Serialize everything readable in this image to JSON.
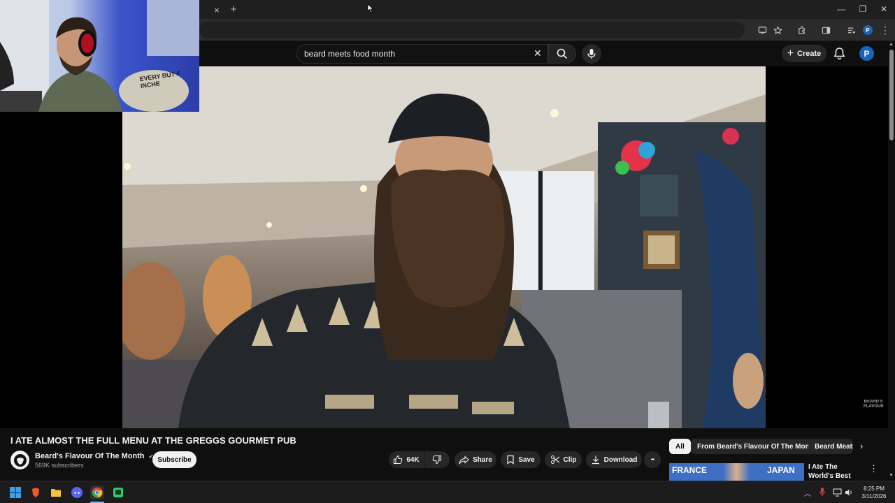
{
  "browser": {
    "new_tab_glyph": "+",
    "close_tab_glyph": "×",
    "window_controls": {
      "minimize": "—",
      "maximize": "❐",
      "close": "✕"
    }
  },
  "youtube": {
    "search": {
      "query": "beard meets food month",
      "clear_glyph": "✕"
    },
    "create_label": "Create",
    "avatar_letter": "P"
  },
  "video": {
    "title": "I ATE ALMOST THE FULL MENU AT THE GREGGS GOURMET PUB",
    "watermark": "BEARD'S FLAVOUR",
    "webcam_shirt_text": "EVERY BUT F INCHE"
  },
  "channel": {
    "name": "Beard's Flavour Of The Month",
    "verified_glyph": "✔",
    "subscribers": "569K subscribers",
    "subscribe_label": "Subscribe"
  },
  "actions": {
    "likes": "64K",
    "share": "Share",
    "save": "Save",
    "clip": "Clip",
    "download": "Download",
    "more_glyph": "•••"
  },
  "chips": [
    "All",
    "From Beard's Flavour Of The Month",
    "Beard Meats"
  ],
  "recommendation": {
    "title": "I Ate The World's Best Sandwich",
    "thumb_left": "FRANCE",
    "thumb_right": "JAPAN"
  },
  "taskbar": {
    "time": "8:25 PM",
    "date": "3/11/2026"
  },
  "colors": {
    "background": "#0f0f0f",
    "avatar": "#1c62b9",
    "pill": "#272727"
  }
}
